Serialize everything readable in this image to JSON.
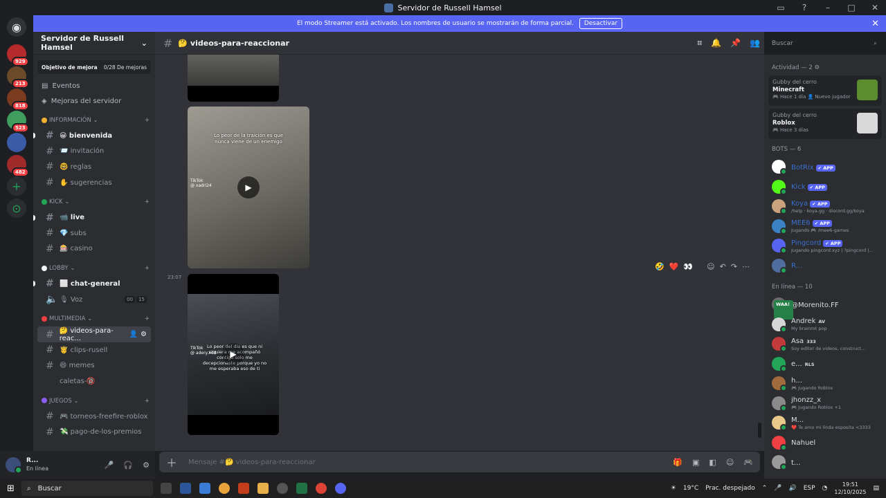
{
  "window": {
    "title": "Servidor de Russell Hamsel"
  },
  "streamer_banner": {
    "text": "El modo Streamer está activado. Los nombres de usuario se mostrarán de forma parcial.",
    "button": "Desactivar"
  },
  "guilds": [
    {
      "badge": "929",
      "color": "#b52a2a"
    },
    {
      "badge": "213",
      "color": "#6b4a2a"
    },
    {
      "badge": "818",
      "color": "#7a3b1f"
    },
    {
      "badge": "523",
      "color": "#3f9d5e"
    },
    {
      "badge": "",
      "color": "#3a5ba8"
    },
    {
      "badge": "482",
      "color": "#a12b2b"
    }
  ],
  "server": {
    "name": "Servidor de Russell Hamsel",
    "goal_label": "Objetivo de mejora",
    "goal_value": "0/28 De mejoras",
    "events": "Eventos",
    "boosts": "Mejoras del servidor",
    "categories": [
      {
        "name": "INFORMACIÓN",
        "dot": "#f0b232",
        "channels": [
          {
            "label": "😀 bienvenida",
            "unread": true
          },
          {
            "label": "📨 invitación",
            "unread": false
          },
          {
            "label": "🤓 reglas",
            "unread": false
          },
          {
            "label": "✋ sugerencias",
            "unread": false
          }
        ]
      },
      {
        "name": "KICK",
        "dot": "#23a559",
        "channels": [
          {
            "label": "📹 live",
            "unread": true
          },
          {
            "label": "💎 subs",
            "unread": false
          },
          {
            "label": "🎰 casino",
            "unread": false
          }
        ]
      },
      {
        "name": "LOBBY",
        "dot": "#f2f3f5",
        "channels": [
          {
            "label": "⬜ chat-general",
            "unread": true
          },
          {
            "label": "🎙 Voz",
            "voice": true,
            "counts": [
              "00",
              "15"
            ]
          }
        ]
      },
      {
        "name": "MULTIMEDIA",
        "dot": "#f23f43",
        "channels": [
          {
            "label": "🤔 videos-para-reac...",
            "active": true
          },
          {
            "label": "🤴 clips-rusell",
            "unread": false
          },
          {
            "label": "😄 memes",
            "unread": false
          },
          {
            "label": "caletas-🔞",
            "unread": false
          }
        ]
      },
      {
        "name": "JUEGOS",
        "dot": "#8b5cf6",
        "channels": [
          {
            "label": "🎮 torneos-freefire-roblox",
            "unread": false
          },
          {
            "label": "💸 pago-de-los-premios",
            "unread": false
          }
        ]
      }
    ]
  },
  "user": {
    "name": "R...",
    "status": "En línea"
  },
  "channel_header": {
    "name": "🤔 videos-para-reaccionar",
    "search_placeholder": "Buscar"
  },
  "messages": {
    "video1": {
      "caption": "Lo peor de la traición es que nunca viene de un enemigo",
      "brand": "TikTok",
      "handle": "@ xadri24"
    },
    "timestamp": "23:07",
    "video2": {
      "caption": "Lo peor del día es que ni siquiera me acompañó contigo solo me decepcionaste porque yo no me esperaba eso de ti",
      "brand": "TikTok",
      "handle": "@ adery.xdd"
    },
    "reactions": [
      "🤣",
      "❤️",
      "👀"
    ]
  },
  "composer": {
    "placeholder": "Mensaje #🤔 videos-para-reaccionar"
  },
  "members": {
    "activity_header": "Actividad — 2",
    "activities": [
      {
        "who": "Gubby del cerro",
        "game": "Minecraft",
        "meta": "🎮 Hace 1 día  👤 Nuevo jugador",
        "thumb": "#5b8c2e"
      },
      {
        "who": "Gubby del cerro",
        "game": "Roblox",
        "meta": "🎮 Hace 3 días",
        "thumb": "#d9d9d9"
      }
    ],
    "bots_header": "BOTS — 6",
    "bots": [
      {
        "name": "BotRix",
        "sub": "",
        "color": "#ffffff"
      },
      {
        "name": "Kick",
        "sub": "",
        "color": "#53fc18"
      },
      {
        "name": "Koya",
        "sub": "/help · koya.gg · discord.gg/koya",
        "color": "#c9a27e"
      },
      {
        "name": "MEE6",
        "sub": "Jugando 🎮 /mee6-games",
        "color": "#3b82c4"
      },
      {
        "name": "Pingcord",
        "sub": "Jugando pingcord.xyz | ?pingcord |...",
        "color": "#5865f2"
      },
      {
        "name": "R...",
        "sub": "",
        "color": "#4f6d9e"
      }
    ],
    "online_header": "En línea — 10",
    "online": [
      {
        "name": "@Morenito.FF",
        "tag": "WAA!",
        "sub": "",
        "color": "#6b6b6b"
      },
      {
        "name": "Andrek",
        "tag": "AV",
        "sub": "My brainrot pop",
        "color": "#d6d6d6"
      },
      {
        "name": "Asa",
        "tag": "333",
        "sub": "Soy editor de videos, construct...",
        "color": "#c23a3a"
      },
      {
        "name": "e...",
        "tag": "RLS",
        "sub": "",
        "color": "#23a559"
      },
      {
        "name": "h...",
        "tag": "",
        "sub": "🎮 Jugando Roblox",
        "color": "#a06a3c"
      },
      {
        "name": "jhonzz_x",
        "tag": "",
        "sub": "🎮 Jugando Roblox +1",
        "color": "#8a8a8a"
      },
      {
        "name": "M...",
        "tag": "",
        "sub": "❤️ Te amo mi linda esposita <3333",
        "color": "#e8c98a"
      },
      {
        "name": "Nahuel",
        "tag": "",
        "sub": "",
        "color": "#f23f43"
      },
      {
        "name": "t...",
        "tag": "",
        "sub": "",
        "color": "#9a9a9a"
      }
    ]
  },
  "taskbar": {
    "search": "Buscar",
    "weather_temp": "19°C",
    "weather_text": "Prac. despejado",
    "lang": "ESP",
    "time": "19:51",
    "date": "12/10/2025"
  }
}
